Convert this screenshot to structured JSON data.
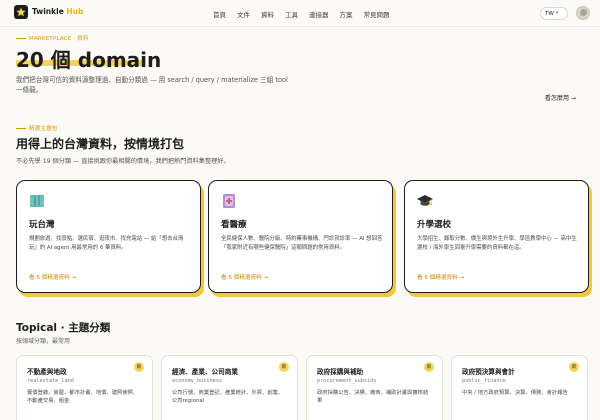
{
  "brand": {
    "name": "Twinkle",
    "name_suffix": "Hub"
  },
  "nav": [
    "首頁",
    "文件",
    "資料",
    "工具",
    "連接器",
    "方案",
    "常見問題"
  ],
  "header": {
    "lang": "TW"
  },
  "hero": {
    "eyebrow": "MARKETPLACE · 資料",
    "title": "20 個 domain",
    "desc": "我們把台灣可信的資料源整理過、自動分類過 — 用 search / query / materialize 三組 tool 一條龍。",
    "see_usage": "看怎麼用 →"
  },
  "scenarios": {
    "eyebrow": "精選主題包",
    "title": "用得上的台灣資料，按情境打包",
    "subtitle": "不必先學 19 個分類 — 直接挑跟你最相關的情境，我們把熱門資料集整理好。",
    "cards": [
      {
        "title": "玩台灣",
        "desc": "規劃旅遊、找景點、選民宿、逛夜市、找充電站 — 給「想去台灣玩」的 AI agent 用最常用的 6 筆資料。",
        "link": "看 6 個精選資料 →"
      },
      {
        "title": "看醫療",
        "desc": "全民健保人數、醫院分級、特約藥事機構、門診就診率 — AI 想回答「我家附近有哪些健保醫院」這類問題的常用資料。",
        "link": "看 6 個精選資料 →"
      },
      {
        "title": "升學選校",
        "desc": "大學招生、錄取分數、僑生與境外生升學、學區教學中心 — 高中生選校 / 海外學生回臺升學需要的資料都在這。",
        "link": "看 6 個精選資料 →"
      }
    ]
  },
  "topical": {
    "title": "Topical · 主題分類",
    "subtitle": "按領域分類，最常用",
    "cards": [
      {
        "title": "不動產與地政",
        "code": "realestate_land",
        "desc": "實價登錄、房屋、都市計畫、地價、建照使照、不動產交易、租金",
        "badge": "新"
      },
      {
        "title": "經濟、產業、公司商業",
        "code": "economy_business",
        "desc": "公司行號、商業登記、產業統計、外貿、創業、公司regional",
        "badge": "新"
      },
      {
        "title": "政府採購與補助",
        "code": "procurement_subsidy",
        "desc": "政府採購公告、決標、廠商、補助計畫與審核結果",
        "badge": "新"
      },
      {
        "title": "政府預決算與會計",
        "code": "public_finance",
        "desc": "中央 / 地方政府預算、決算、債務、會計報告",
        "badge": "新"
      }
    ]
  },
  "colors": {
    "accent": "#f6d45c",
    "accent_text": "#c98a00",
    "ink": "#1d1d1b"
  },
  "icons": {
    "card1": "map-icon",
    "card2": "medical-book-icon",
    "card3": "graduation-cap-icon"
  }
}
